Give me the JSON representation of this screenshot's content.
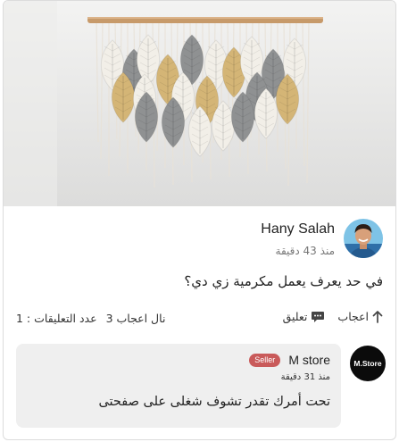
{
  "post": {
    "image_alt": "macrame leaf wall hanging",
    "author": {
      "name": "Hany Salah",
      "time": "منذ 43 دقيقة"
    },
    "text": "في حد يعرف يعمل مكرمية زي دي؟",
    "actions": {
      "like_label": "اعجاب",
      "comment_label": "تعليق"
    },
    "stats": {
      "likes": "نال اعجاب 3",
      "comments_count": "عدد التعليقات : 1"
    }
  },
  "comment": {
    "avatar_text": "M.Store",
    "author": "M store",
    "badge": "Seller",
    "time": "منذ 31 دقيقة",
    "text": "تحت أمرك تقدر تشوف شغلى على صفحتى"
  },
  "colors": {
    "seller_badge": "#c95a5a",
    "bubble_bg": "#efefef",
    "card_border": "#dcdcdc"
  },
  "icons": {
    "like": "arrow-up-icon",
    "comment": "speech-bubble-icon"
  }
}
